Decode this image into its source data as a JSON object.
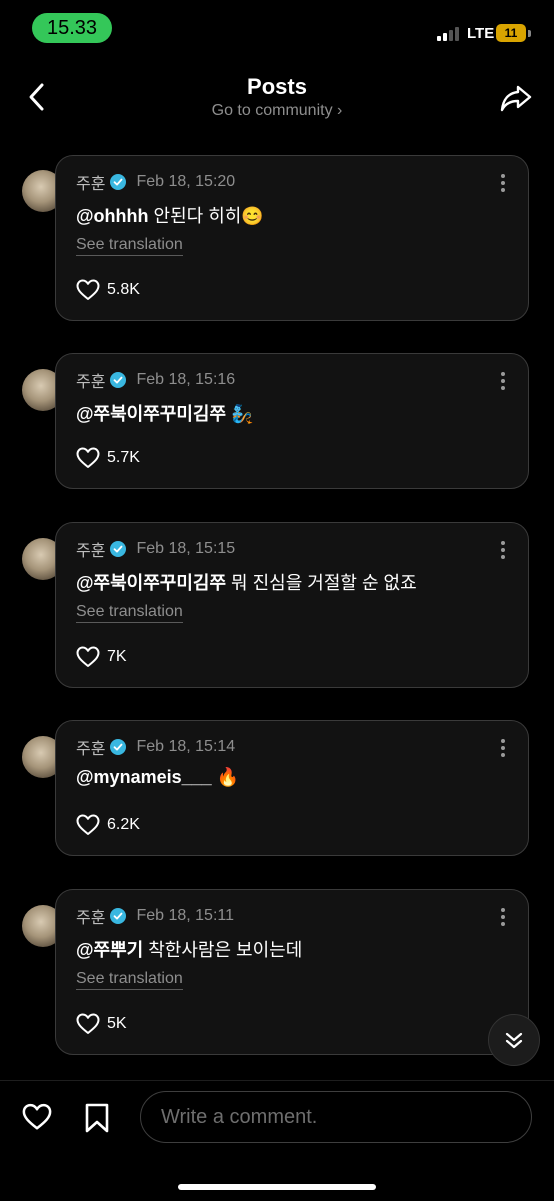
{
  "status_bar": {
    "time": "15.33",
    "network": "LTE",
    "battery": "11"
  },
  "header": {
    "title": "Posts",
    "community_link": "Go to community ›"
  },
  "posts": [
    {
      "author": "주훈",
      "date": "Feb 18, 15:20",
      "mention": "@ohhhh",
      "text": " 안된다 히히😊",
      "translation": "See translation",
      "likes": "5.8K"
    },
    {
      "author": "주훈",
      "date": "Feb 18, 15:16",
      "mention": "@쭈북이쭈꾸미김쭈",
      "text": " 🧞",
      "translation": "",
      "likes": "5.7K"
    },
    {
      "author": "주훈",
      "date": "Feb 18, 15:15",
      "mention": "@쭈북이쭈꾸미김쭈",
      "text": " 뭐 진심을 거절할 순 없죠",
      "translation": "See translation",
      "likes": "7K"
    },
    {
      "author": "주훈",
      "date": "Feb 18, 15:14",
      "mention": "@mynameis___",
      "text": " 🔥",
      "translation": "",
      "likes": "6.2K"
    },
    {
      "author": "주훈",
      "date": "Feb 18, 15:11",
      "mention": "@쭈뿌기",
      "text": " 착한사람은 보이는데",
      "translation": "See translation",
      "likes": "5K"
    }
  ],
  "comment_box": {
    "placeholder": "Write a comment."
  },
  "colors": {
    "accent_green": "#34c759",
    "verified": "#39b7e0",
    "card_bg": "#121212",
    "battery": "#d9a400"
  },
  "icons": {
    "back": "chevron-left-icon",
    "share": "share-arrow-icon",
    "verified": "verified-badge-icon",
    "more": "more-vertical-icon",
    "heart": "heart-outline-icon",
    "bookmark": "bookmark-outline-icon",
    "scroll": "double-chevron-down-icon"
  }
}
